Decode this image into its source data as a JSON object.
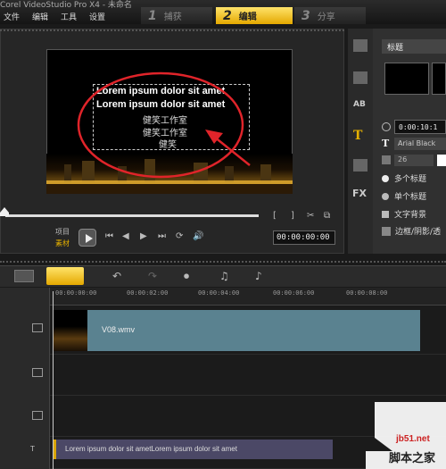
{
  "window_title": "Corel VideoStudio Pro X4 - 未命名",
  "menu": [
    "文件",
    "编辑",
    "工具",
    "设置"
  ],
  "steps": [
    {
      "num": "1",
      "label": "捕获"
    },
    {
      "num": "2",
      "label": "编辑"
    },
    {
      "num": "3",
      "label": "分享"
    }
  ],
  "preview": {
    "lines_en": [
      "Lorem ipsum dolor sit amet",
      "Lorem ipsum dolor sit amet"
    ],
    "lines_cn": [
      "健笑工作室",
      "健笑工作室",
      "健笑"
    ],
    "mode_project": "项目",
    "mode_clip": "素材",
    "timecode": "00:00:00:00"
  },
  "right_panel": {
    "category": "标题",
    "duration": "0:00:10:1",
    "font": "Arial Black",
    "font_size": "26",
    "option_multi": "多个标题",
    "option_single": "单个标题",
    "option_bg": "文字背景",
    "option_border": "边框/阴影/透",
    "fx_label": "FX",
    "ab_label": "AB"
  },
  "timeline": {
    "ruler": [
      "00:00:00:00",
      "00:00:02:00",
      "00:00:04:00",
      "00:00:06:00",
      "00:00:08:00"
    ],
    "video_clip": "V08.wmv",
    "title_clip": "Lorem ipsum dolor sit ametLorem ipsum dolor sit amet"
  },
  "watermark": {
    "line1": "jb51.net",
    "line2": "脚本之家"
  }
}
